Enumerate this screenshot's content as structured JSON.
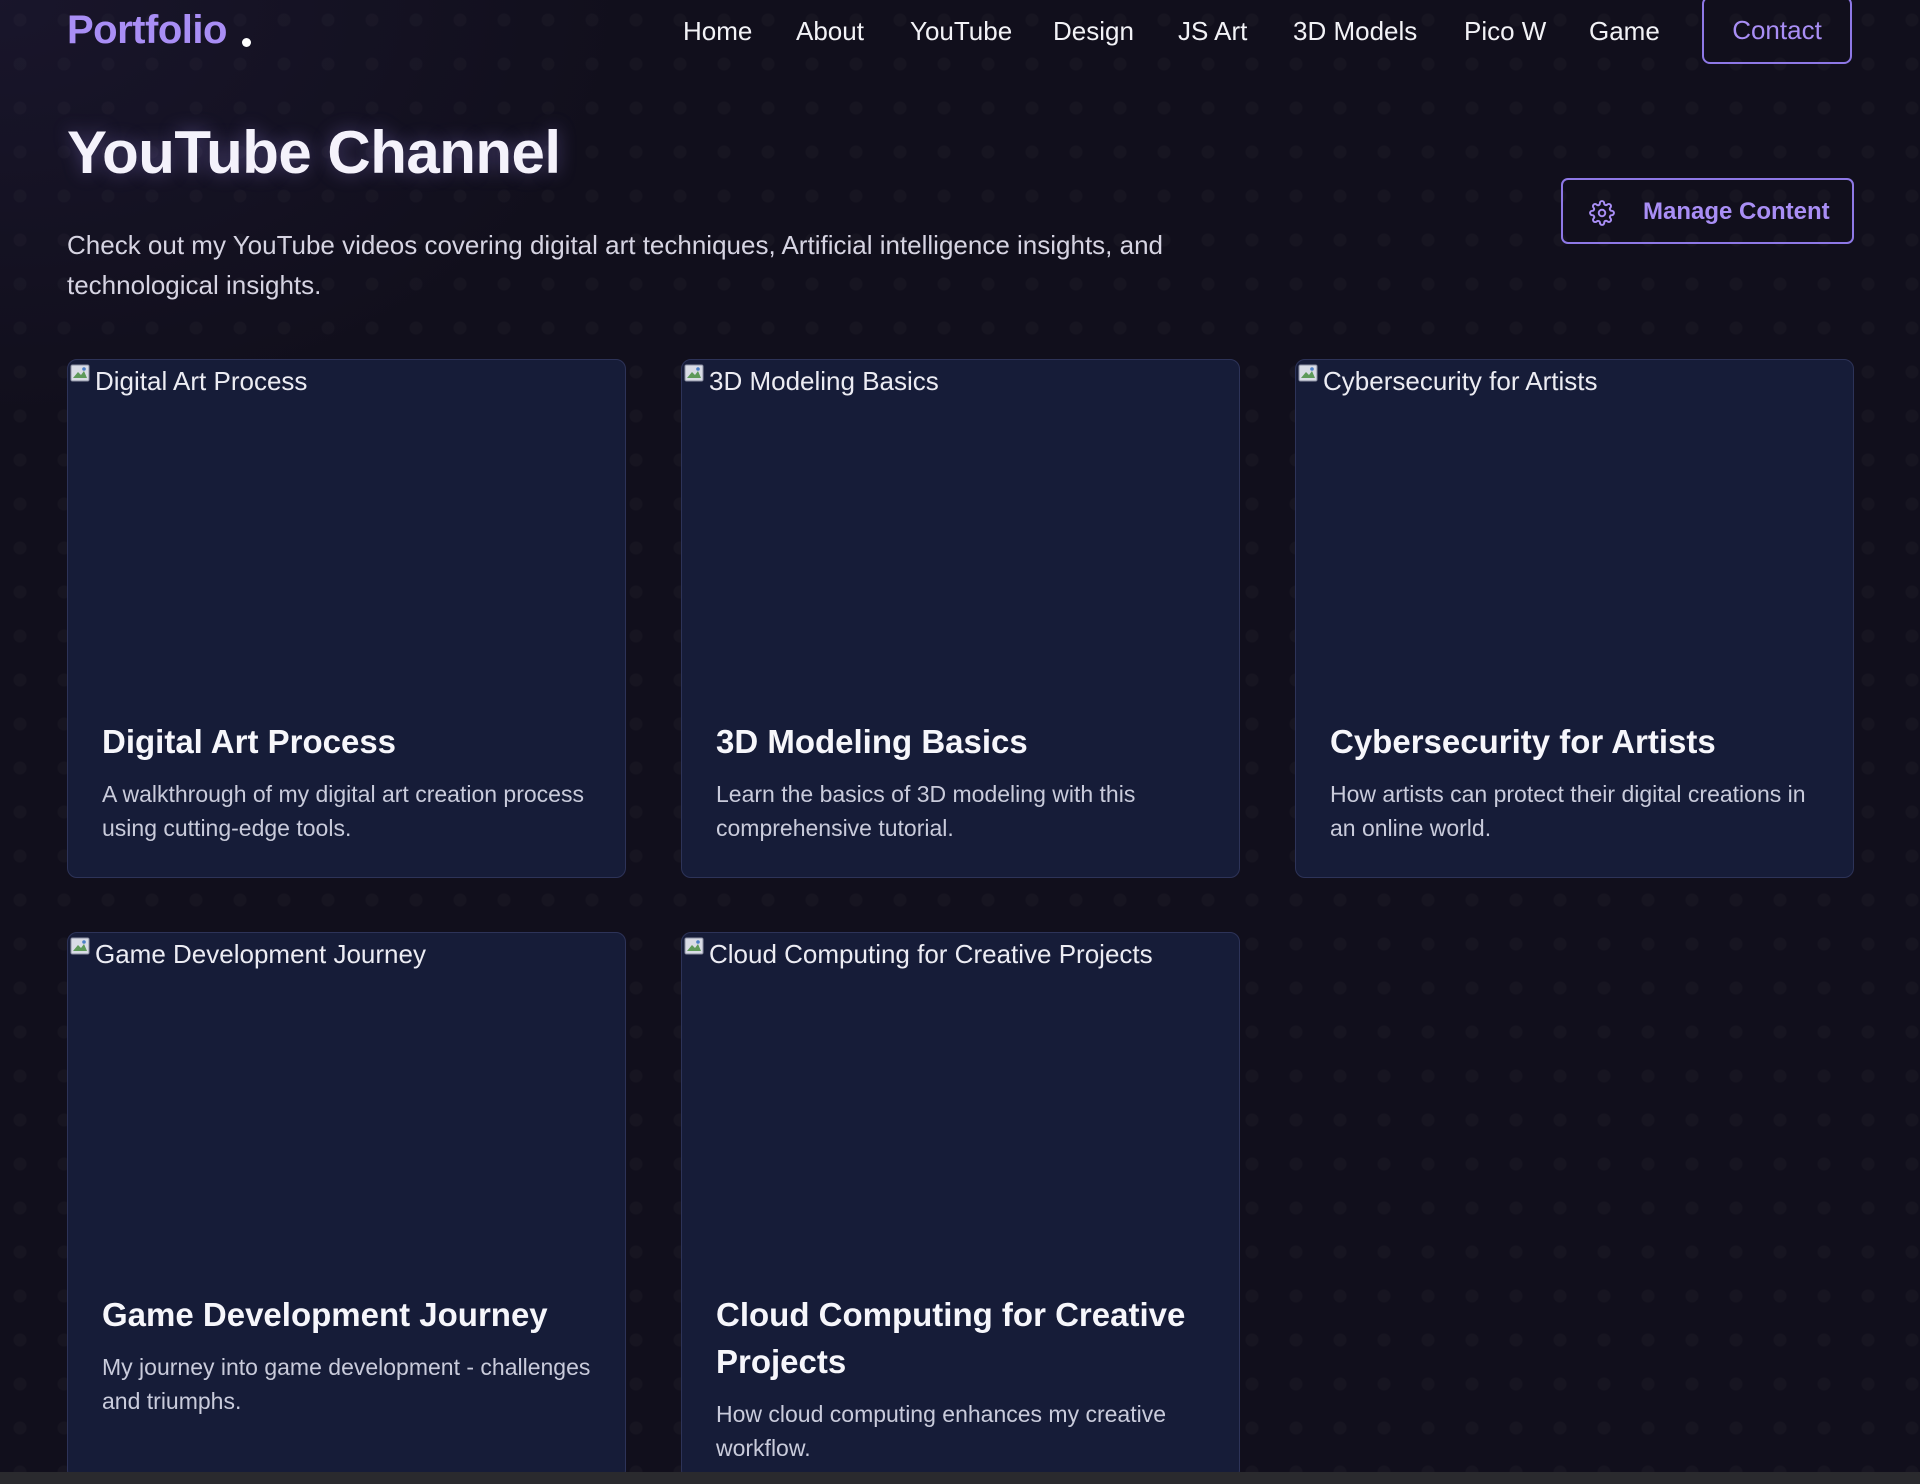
{
  "nav": {
    "logo": "Portfolio",
    "links": [
      "Home",
      "About",
      "YouTube",
      "Design",
      "JS Art",
      "3D Models",
      "Pico W",
      "Game"
    ],
    "contact": "Contact"
  },
  "header": {
    "title": "YouTube Channel",
    "description": "Check out my YouTube videos covering digital art techniques, Artificial intelligence insights, and technological insights.",
    "manage_button": "Manage Content"
  },
  "videos": [
    {
      "thumb_alt": "Digital Art Process",
      "title": "Digital Art Process",
      "description": "A walkthrough of my digital art creation process using cutting-edge tools."
    },
    {
      "thumb_alt": "3D Modeling Basics",
      "title": "3D Modeling Basics",
      "description": "Learn the basics of 3D modeling with this comprehensive tutorial."
    },
    {
      "thumb_alt": "Cybersecurity for Artists",
      "title": "Cybersecurity for Artists",
      "description": "How artists can protect their digital creations in an online world."
    },
    {
      "thumb_alt": "Game Development Journey",
      "title": "Game Development Journey",
      "description": "My journey into game development - challenges and triumphs."
    },
    {
      "thumb_alt": "Cloud Computing for Creative Projects",
      "title": "Cloud Computing for Creative Projects",
      "description": "How cloud computing enhances my creative workflow."
    }
  ],
  "colors": {
    "background": "#110f1c",
    "accent": "#a98ef5",
    "card": "#161c38"
  },
  "icons": {
    "manage": "gear-icon",
    "thumbnail": "broken-image-icon"
  }
}
